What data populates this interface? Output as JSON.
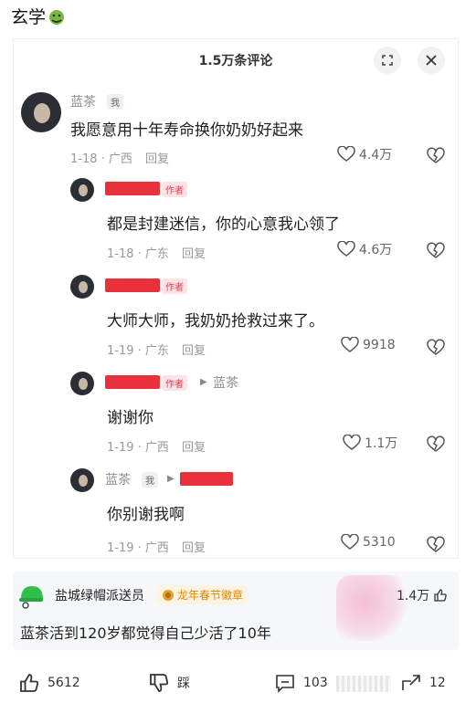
{
  "post": {
    "title": "玄学",
    "emoji": "sick-face-emoji"
  },
  "screenshot": {
    "header_title": "1.5万条评论",
    "comments": [
      {
        "user": "蓝茶",
        "tag": "我",
        "text": "我愿意用十年寿命换你奶奶好起来",
        "date": "1-18",
        "location": "广西",
        "reply": "回复",
        "likes": "4.4万"
      },
      {
        "tag": "作者",
        "text": "都是封建迷信，你的心意我心领了",
        "date": "1-18",
        "location": "广东",
        "reply": "回复",
        "likes": "4.6万"
      },
      {
        "tag": "作者",
        "text": "大师大师，我奶奶抢救过来了。",
        "date": "1-19",
        "location": "广东",
        "reply": "回复",
        "likes": "9918"
      },
      {
        "tag": "作者",
        "reply_to": "蓝茶",
        "text": "谢谢你",
        "date": "1-19",
        "location": "广西",
        "reply": "回复",
        "likes": "1.1万"
      },
      {
        "user": "蓝茶",
        "tag": "我",
        "text": "你别谢我啊",
        "date": "1-19",
        "location": "广西",
        "reply": "回复",
        "likes": "5310"
      }
    ]
  },
  "bottom_comment": {
    "user": "盐城绿帽派送员",
    "badge": "龙年春节徽章",
    "likes": "1.4万",
    "text": "蓝茶活到120岁都觉得自己少活了10年"
  },
  "actions": {
    "likes": "5612",
    "dislike": "踩",
    "comments": "103",
    "shares": "12"
  },
  "colors": {
    "author_red": "#e8313b",
    "badge_orange": "#e08a00",
    "muted": "#999999"
  }
}
